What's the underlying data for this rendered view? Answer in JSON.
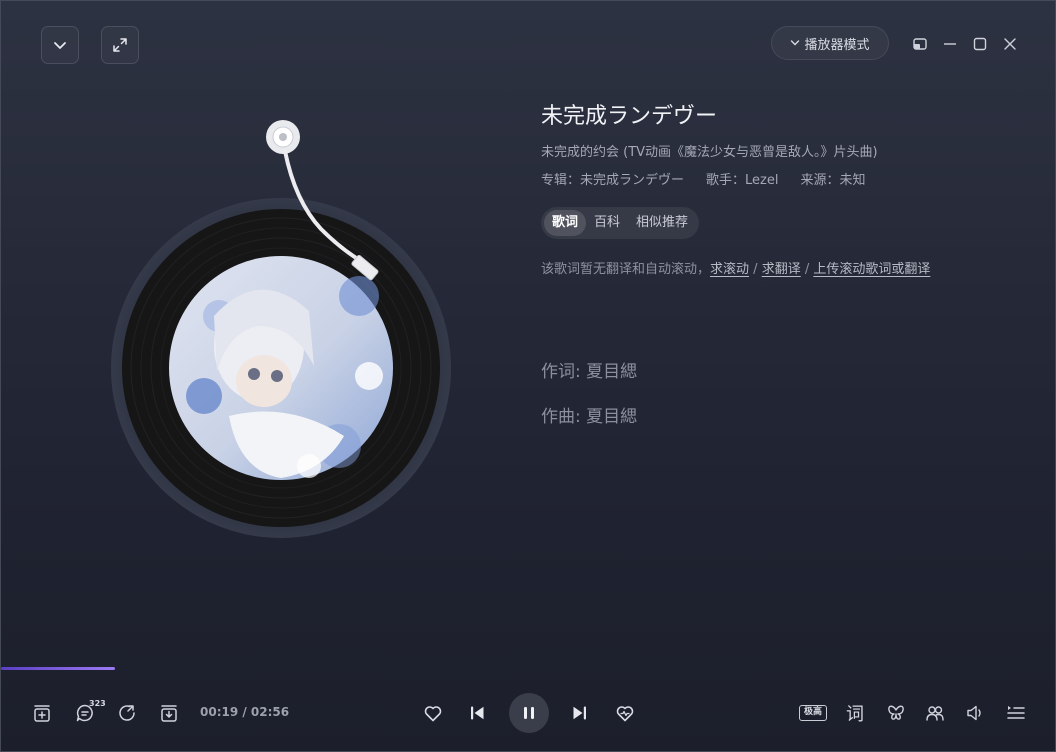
{
  "header": {
    "player_mode_label": "播放器模式"
  },
  "song": {
    "title": "未完成ランデヴー",
    "subtitle": "未完成的约会 (TV动画《魔法少女与恶曾是敌人。》片头曲)",
    "album": "专辑：未完成ランデヴー",
    "singer": "歌手：Lezel",
    "source": "来源：未知"
  },
  "tabs": [
    {
      "label": "歌词",
      "active": true
    },
    {
      "label": "百科",
      "active": false
    },
    {
      "label": "相似推荐",
      "active": false
    }
  ],
  "notice": {
    "text": "该歌词暂无翻译和自动滚动，",
    "link1": "求滚动",
    "sep1": " / ",
    "link2": "求翻译",
    "sep2": " / ",
    "link3": "上传滚动歌词或翻译"
  },
  "lyrics": [
    "作词: 夏目緦",
    "作曲: 夏目緦"
  ],
  "playback": {
    "current_time": "00:19",
    "total_time": "02:56",
    "time_display": "00:19 / 02:56",
    "progress": 0.108,
    "comment_count": "323",
    "quality_label": "极高",
    "lyric_toggle_label": "词"
  },
  "colors": {
    "accent": "#8f6cf0",
    "background": "#262a38"
  }
}
